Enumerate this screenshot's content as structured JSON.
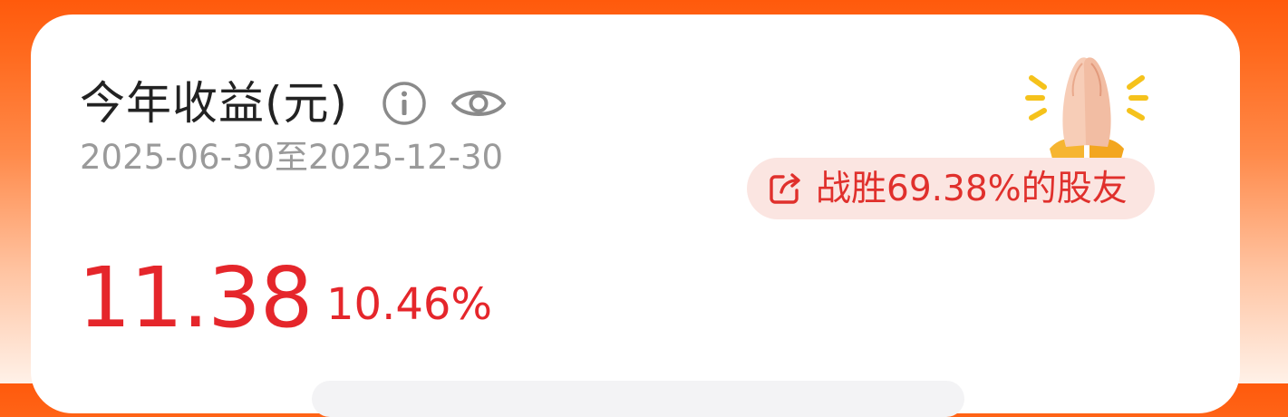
{
  "header": {
    "title": "今年收益(元)",
    "date_range": "2025-06-30至2025-12-30"
  },
  "earnings": {
    "amount": "11.38",
    "percent": "10.46%"
  },
  "badge": {
    "text": "战胜69.38%的股友"
  },
  "icons": {
    "info": "info-icon",
    "visibility": "eye-icon",
    "share": "share-icon",
    "illustration": "clapping-hands-icon"
  },
  "colors": {
    "accent_orange": "#ff5a0c",
    "gain_red": "#e5262b",
    "badge_bg": "#fbe5e1"
  }
}
